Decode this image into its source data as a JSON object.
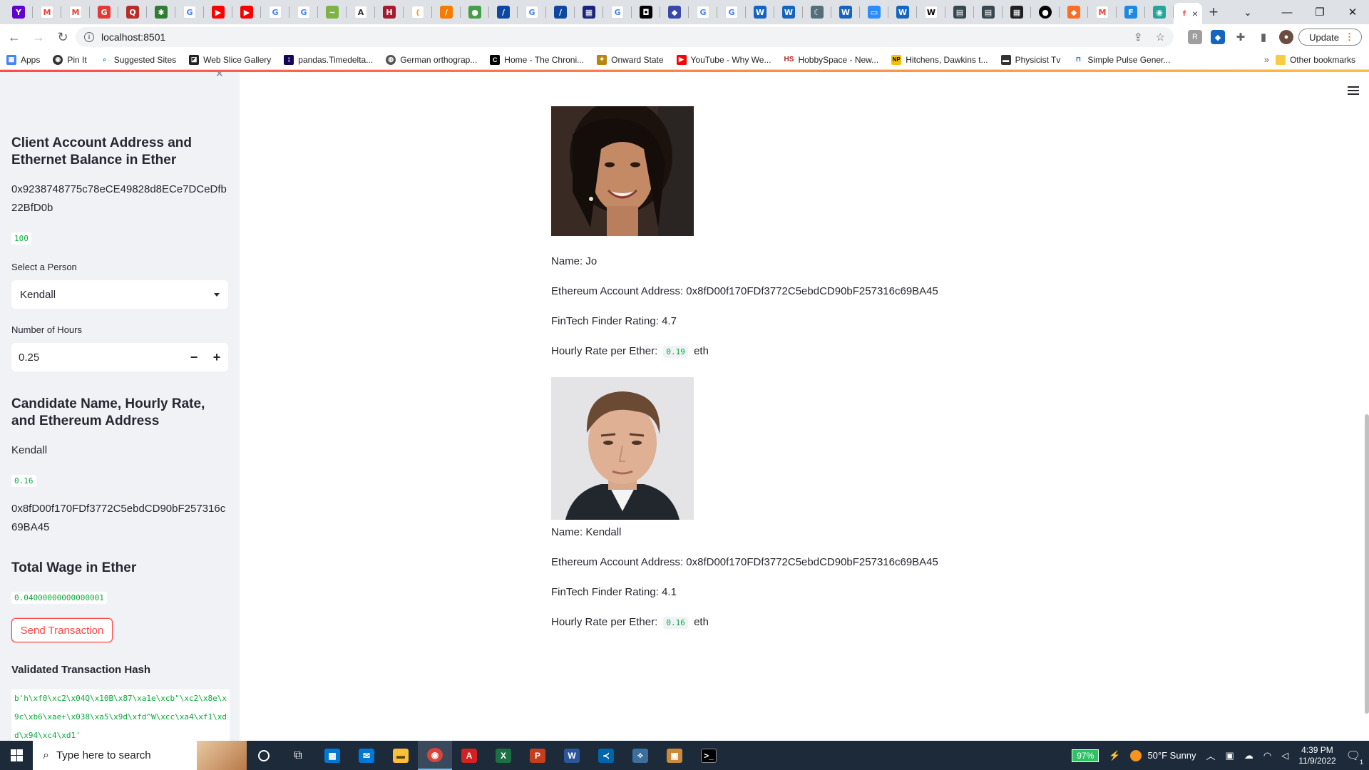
{
  "browser": {
    "url": "localhost:8501",
    "update_label": "Update",
    "tab_close": "×",
    "bookmarks": [
      {
        "label": "Apps",
        "color": "#4285f4"
      },
      {
        "label": "Pin It",
        "color": "#333333"
      },
      {
        "label": "Suggested Sites",
        "color": "#1a73e8"
      },
      {
        "label": "Web Slice Gallery",
        "color": "#222222"
      },
      {
        "label": "pandas.Timedelta...",
        "color": "#150458"
      },
      {
        "label": "German orthograp...",
        "color": "#555555"
      },
      {
        "label": "Home - The Chroni...",
        "color": "#000000"
      },
      {
        "label": "Onward State",
        "color": "#b8860b"
      },
      {
        "label": "YouTube - Why We...",
        "color": "#ff0000"
      },
      {
        "label": "HobbySpace - New...",
        "color": "#b22222"
      },
      {
        "label": "Hitchens, Dawkins t...",
        "color": "#f4c20d"
      },
      {
        "label": "Physicist Tv",
        "color": "#333333"
      },
      {
        "label": "Simple Pulse Gener...",
        "color": "#1565c0"
      }
    ],
    "other_bookmarks": "Other bookmarks"
  },
  "sidebar": {
    "account_heading": "Client Account Address and Ethernet Balance in Ether",
    "account_address": "0x9238748775c78eCE49828d8ECe7DCeDfb22BfD0b",
    "balance": "100",
    "select_label": "Select a Person",
    "select_value": "Kendall",
    "hours_label": "Number of Hours",
    "hours_value": "0.25",
    "stepper_minus": "−",
    "stepper_plus": "+",
    "candidate_heading": "Candidate Name, Hourly Rate, and Ethereum Address",
    "candidate_name": "Kendall",
    "candidate_rate": "0.16",
    "candidate_address": "0x8fD00f170FDf3772C5ebdCD90bF257316c69BA45",
    "wage_heading": "Total Wage in Ether",
    "wage_value": "0.04000000000000001",
    "send_button": "Send Transaction",
    "hash_heading": "Validated Transaction Hash",
    "hash_value": "b'h\\xf0\\xc2\\x04Q\\x10B\\x87\\xa1e\\xcb\"\\xc2\\x8e\\x9c\\xb6\\xae+\\x038\\xa5\\x9d\\xfd^W\\xcc\\xa4\\xf1\\xdd\\x94\\xc4\\xd1'"
  },
  "candidates": [
    {
      "name": "Name: Jo",
      "address": "Ethereum Account Address: 0x8fD00f170FDf3772C5ebdCD90bF257316c69BA45",
      "rating": "FinTech Finder Rating: 4.7",
      "rate_label": "Hourly Rate per Ether:",
      "rate_value": "0.19",
      "rate_unit": "eth"
    },
    {
      "name": "Name: Kendall",
      "address": "Ethereum Account Address: 0x8fD00f170FDf3772C5ebdCD90bF257316c69BA45",
      "rating": "FinTech Finder Rating: 4.1",
      "rate_label": "Hourly Rate per Ether:",
      "rate_value": "0.16",
      "rate_unit": "eth"
    }
  ],
  "taskbar": {
    "search_placeholder": "Type here to search",
    "battery": "97%",
    "weather": "50°F  Sunny",
    "time": "4:39 PM",
    "date": "11/9/2022",
    "notifications": "1"
  },
  "colors": {
    "accent": "#ff4b4b",
    "code_green": "#09ab3b",
    "sidebar_bg": "#f0f2f6",
    "taskbar_bg": "#1c2a3a"
  }
}
